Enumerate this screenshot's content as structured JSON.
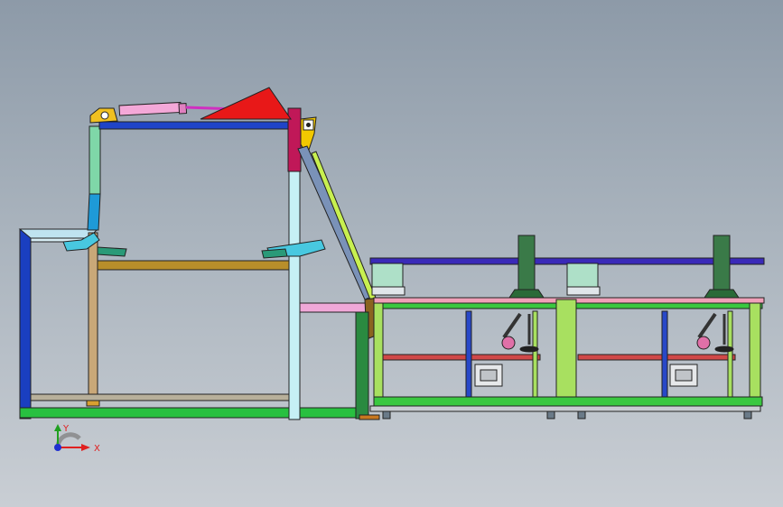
{
  "viewport": {
    "background_top": "#8d9aa8",
    "background_bottom": "#c9ced4"
  },
  "triad": {
    "x_label": "X",
    "y_label": "Y",
    "x_color": "#e02020",
    "y_color": "#20a020",
    "z_color": "#2030d0"
  },
  "model": {
    "parts": [
      "frame-left",
      "frame-tall",
      "pneumatic-cylinder",
      "red-plate",
      "inclined-conveyor",
      "rail-conveyor",
      "workstation-1",
      "workstation-2"
    ]
  }
}
